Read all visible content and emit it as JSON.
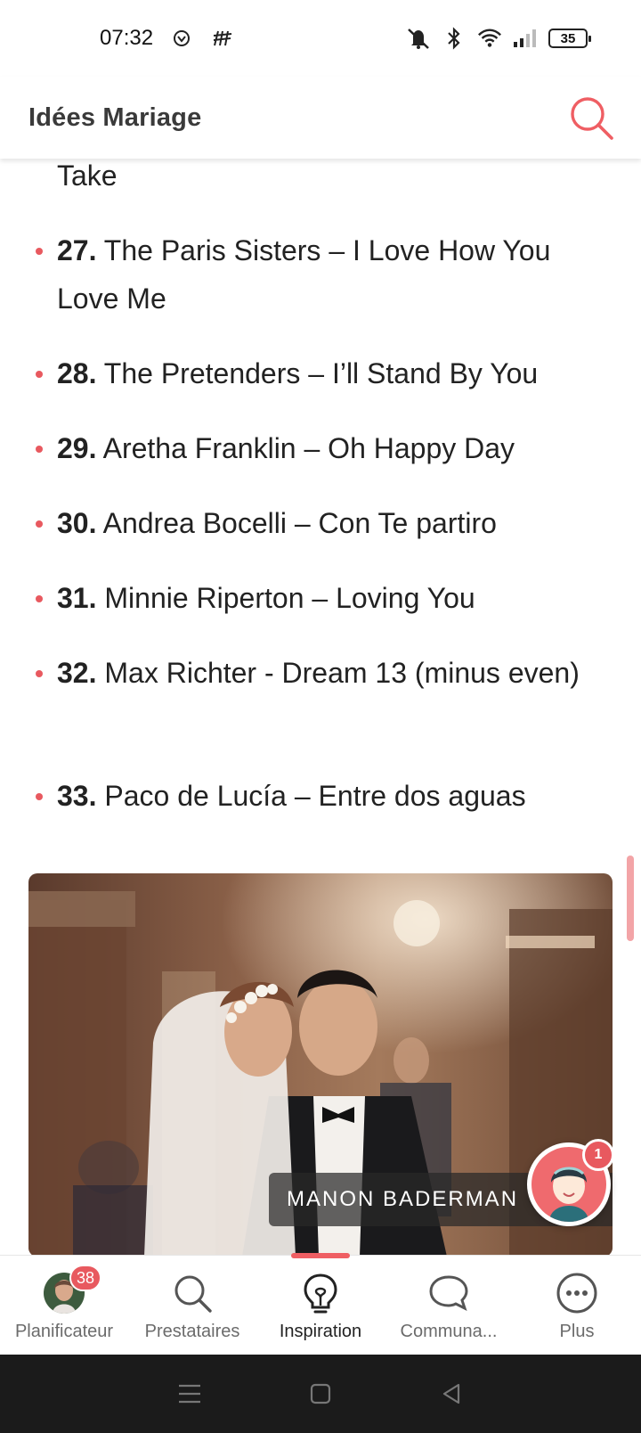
{
  "status_bar": {
    "time": "07:32",
    "battery": "35",
    "icons": [
      "notification-app-icon",
      "notification-app-icon-2",
      "mute-icon",
      "bluetooth-icon",
      "wifi-icon",
      "signal-icon",
      "battery-icon"
    ]
  },
  "header": {
    "title": "Idées Mariage",
    "search_icon": "search-icon",
    "accent_color": "#ef5e63"
  },
  "article": {
    "continued_text": "Take",
    "songs": [
      {
        "num": "27.",
        "text": " The Paris Sisters – I Love How You Love Me"
      },
      {
        "num": "28.",
        "text": " The Pretenders – I’ll Stand By You"
      },
      {
        "num": "29.",
        "text": " Aretha Franklin – Oh Happy Day"
      },
      {
        "num": "30.",
        "text": " Andrea Bocelli – Con Te partiro"
      },
      {
        "num": "31.",
        "text": " Minnie Riperton – Loving You"
      },
      {
        "num": "32.",
        "text": " Max Richter - Dream 13 (minus even)"
      },
      {
        "num": "33.",
        "text": " Paco de Lucía – Entre dos aguas"
      }
    ],
    "photo": {
      "credit": "MANON BADERMAN"
    }
  },
  "assistant": {
    "badge": "1"
  },
  "bottom_nav": {
    "items": [
      {
        "label": "Planificateur",
        "icon": "avatar",
        "badge": "38"
      },
      {
        "label": "Prestataires",
        "icon": "search-icon"
      },
      {
        "label": "Inspiration",
        "icon": "lightbulb-icon",
        "active": true
      },
      {
        "label": "Communa...",
        "icon": "chat-bubble-icon"
      },
      {
        "label": "Plus",
        "icon": "more-dots-icon"
      }
    ]
  },
  "android_nav": {
    "icons": [
      "menu-icon",
      "home-icon",
      "back-icon"
    ]
  }
}
